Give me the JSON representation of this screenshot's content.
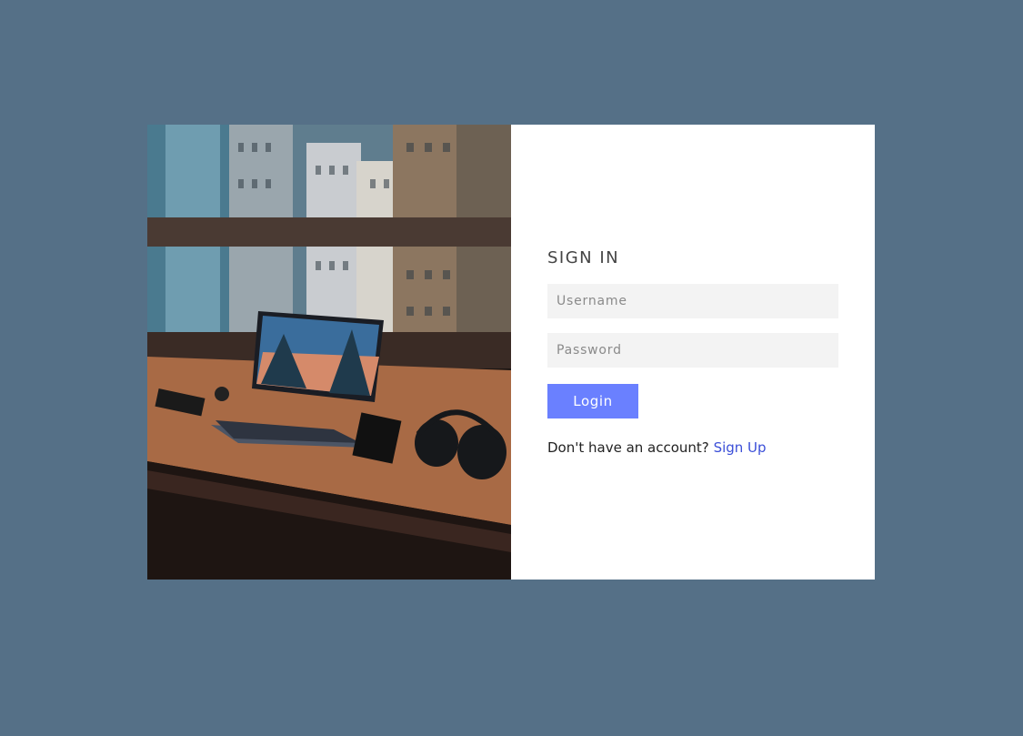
{
  "colors": {
    "page_background": "#557087",
    "card_background": "#ffffff",
    "input_background": "#f3f3f3",
    "accent": "#6a80ff",
    "link": "#3b4fd8"
  },
  "image": {
    "icon": "laptop-desk-city-photo"
  },
  "form": {
    "title": "SIGN IN",
    "username_placeholder": "Username",
    "password_placeholder": "Password",
    "login_label": "Login",
    "signup_prompt": "Don't have an account?",
    "signup_link": "Sign Up"
  }
}
